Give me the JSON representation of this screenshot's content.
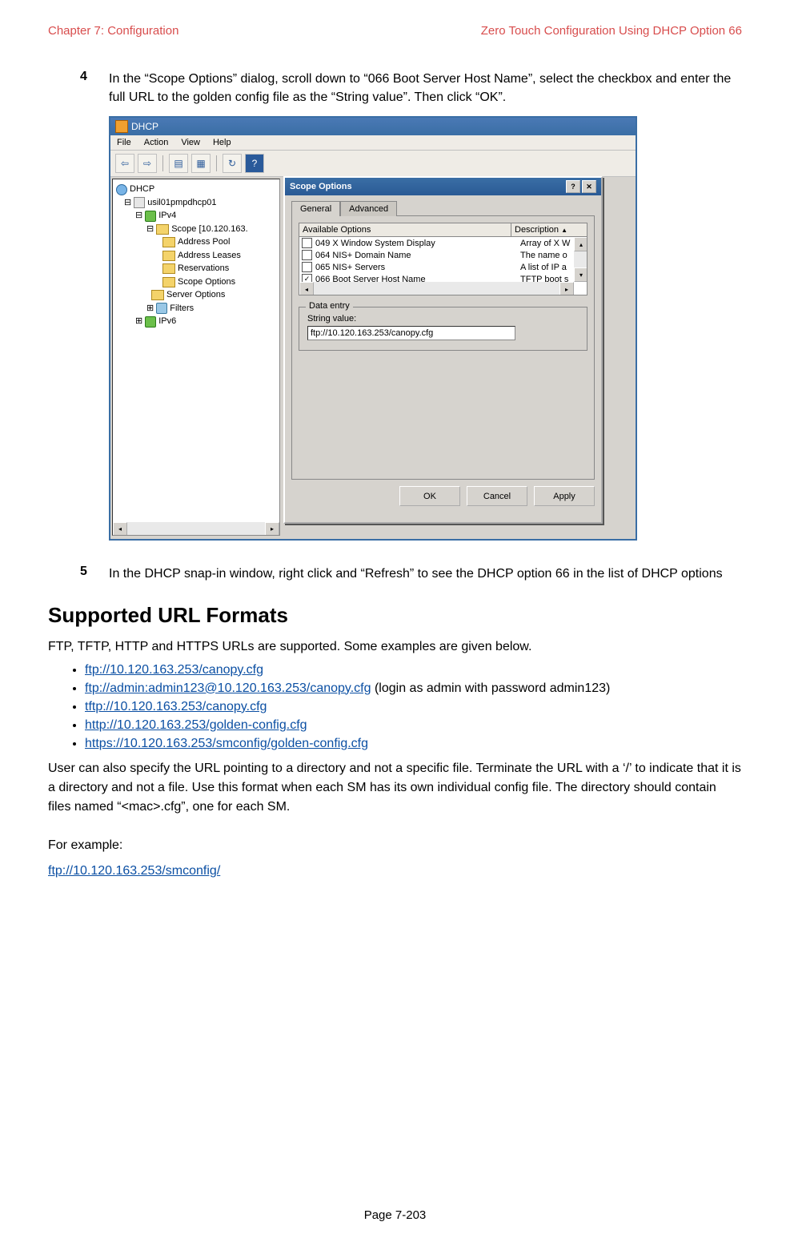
{
  "header": {
    "left": "Chapter 7:  Configuration",
    "right": "Zero Touch Configuration Using DHCP Option 66"
  },
  "steps": {
    "s4": {
      "num": "4",
      "text": "In the “Scope Options” dialog, scroll down to “066 Boot Server Host Name”, select the checkbox and enter the full URL to the golden config file as the “String value”. Then click “OK”."
    },
    "s5": {
      "num": "5",
      "text": "In the DHCP snap-in window, right click and “Refresh” to see the DHCP option 66 in the list of DHCP options"
    }
  },
  "mmc": {
    "title": "DHCP",
    "menu": {
      "file": "File",
      "action": "Action",
      "view": "View",
      "help": "Help"
    },
    "tree": {
      "root": "DHCP",
      "server": "usil01pmpdhcp01",
      "ipv4": "IPv4",
      "scope": "Scope [10.120.163.",
      "addr_pool": "Address Pool",
      "addr_leases": "Address Leases",
      "reservations": "Reservations",
      "scope_options": "Scope Options",
      "server_options": "Server Options",
      "filters": "Filters",
      "ipv6": "IPv6"
    }
  },
  "dlg": {
    "title": "Scope Options",
    "tabs": {
      "general": "General",
      "advanced": "Advanced"
    },
    "cols": {
      "c1": "Available Options",
      "c2": "Description"
    },
    "rows": [
      {
        "chk": "",
        "name": "049 X Window System Display",
        "desc": "Array of X W"
      },
      {
        "chk": "",
        "name": "064 NIS+ Domain Name",
        "desc": "The name o"
      },
      {
        "chk": "",
        "name": "065 NIS+ Servers",
        "desc": "A list of IP a"
      },
      {
        "chk": "✓",
        "name": "066 Boot Server Host Name",
        "desc": "TFTP boot s"
      }
    ],
    "group": {
      "legend": "Data entry",
      "label": "String value:",
      "value": "ftp://10.120.163.253/canopy.cfg"
    },
    "buttons": {
      "ok": "OK",
      "cancel": "Cancel",
      "apply": "Apply"
    }
  },
  "section_title": "Supported URL Formats",
  "para1": "FTP, TFTP, HTTP and HTTPS URLs are supported. Some examples are given below.",
  "url_list": {
    "u1": "ftp://10.120.163.253/canopy.cfg",
    "u2": "ftp://admin:admin123@10.120.163.253/canopy.cfg",
    "u2_suffix": "  (login as admin with password admin123)",
    "u3": "tftp://10.120.163.253/canopy.cfg",
    "u4": "http://10.120.163.253/golden-config.cfg",
    "u5": "https://10.120.163.253/smconfig/golden-config.cfg"
  },
  "para2": "User can also specify the URL pointing to a directory and not a specific file. Terminate the URL with a ‘/’ to indicate that it is a directory and not a file. Use this format when each SM has its own individual config file. The directory should contain files named “<mac>.cfg”, one for each SM.",
  "example_label": "For example:",
  "example_url": "ftp://10.120.163.253/smconfig/",
  "footer": "Page 7-203"
}
